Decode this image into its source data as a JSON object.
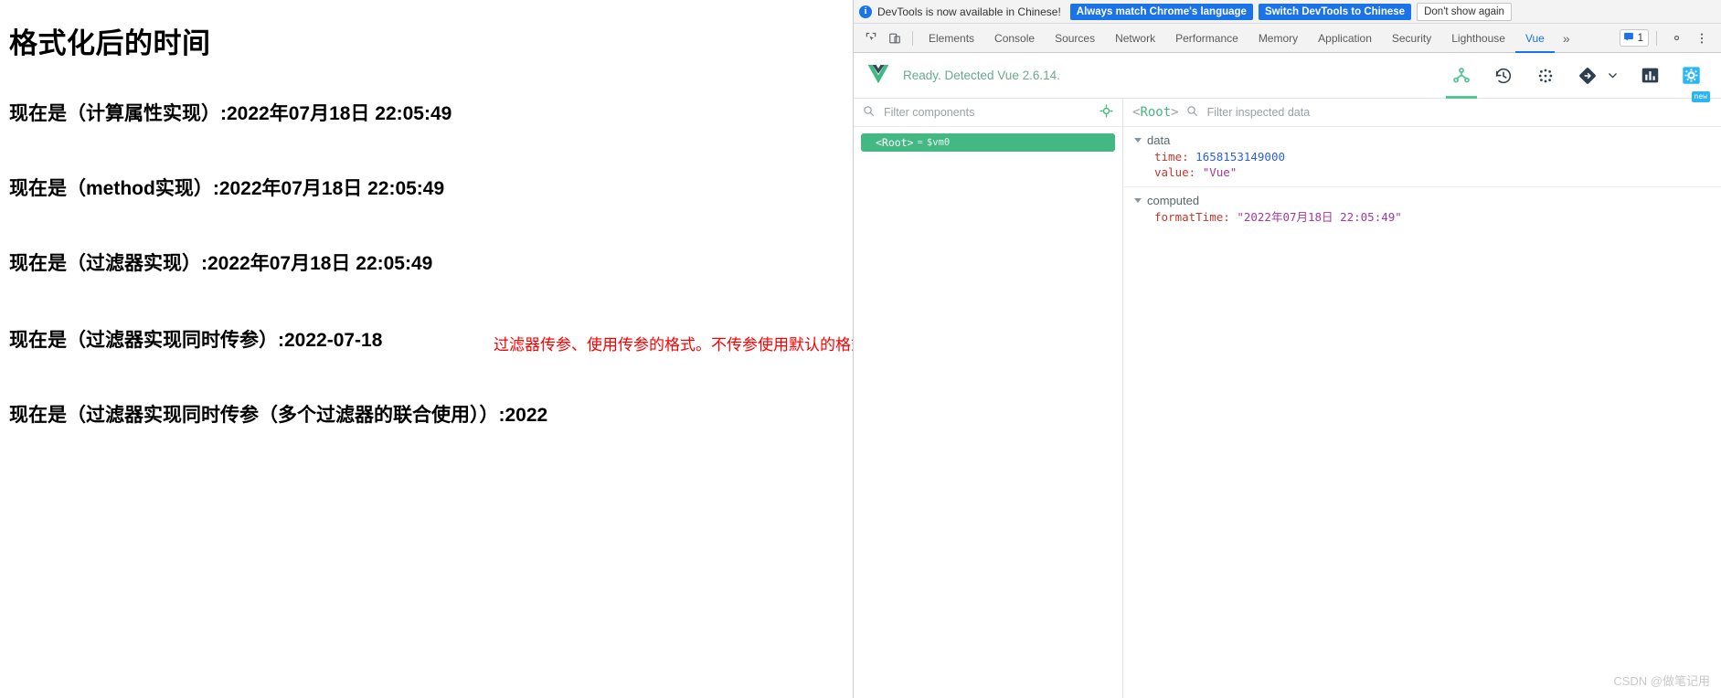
{
  "page": {
    "title": "格式化后的时间",
    "lines": [
      "现在是（计算属性实现）:2022年07月18日 22:05:49",
      "现在是（method实现）:2022年07月18日 22:05:49",
      "现在是（过滤器实现）:2022年07月18日 22:05:49",
      "现在是（过滤器实现同时传参）:2022-07-18",
      "现在是（过滤器实现同时传参（多个过滤器的联合使用））:2022"
    ],
    "note": "过滤器传参、使用传参的格式。不传参使用默认的格式",
    "note_color": "#ff0000"
  },
  "devtools": {
    "notification": {
      "icon": "info-icon",
      "message": "DevTools is now available in Chinese!",
      "primary_button": "Always match Chrome's language",
      "secondary_button": "Switch DevTools to Chinese",
      "dismiss_button": "Don't show again",
      "accent": "#1a73e8"
    },
    "toolbar": {
      "inspect_icon": "inspect-element-icon",
      "device_icon": "device-toolbar-icon",
      "tabs": [
        "Elements",
        "Console",
        "Sources",
        "Network",
        "Performance",
        "Memory",
        "Application",
        "Security",
        "Lighthouse",
        "Vue"
      ],
      "active_tab": "Vue",
      "more_tabs_icon": "chevron-double-right-icon",
      "message_count": "1",
      "message_icon": "message-icon",
      "settings_icon": "gear-icon",
      "menu_icon": "kebab-menu-icon",
      "active_color": "#1a73e8"
    },
    "vue": {
      "logo": "vue-logo-icon",
      "status": "Ready. Detected Vue 2.6.14.",
      "status_color": "#6aab8e",
      "accent": "#44b883",
      "actions": [
        {
          "name": "components-tree-icon",
          "active": true,
          "badge": ""
        },
        {
          "name": "timeline-history-icon",
          "active": false,
          "badge": ""
        },
        {
          "name": "vuex-icon",
          "active": false,
          "badge": ""
        },
        {
          "name": "routing-icon",
          "active": false,
          "badge": ""
        },
        {
          "name": "performance-icon",
          "active": false,
          "badge": ""
        },
        {
          "name": "settings-gear-icon",
          "active": false,
          "badge": "new"
        }
      ],
      "tree": {
        "search_icon": "search-icon",
        "filter_placeholder": "Filter components",
        "filter_value": "",
        "target_icon": "select-in-page-icon",
        "nodes": [
          {
            "tag": "<Root>",
            "eq": "=",
            "vm": "$vm0",
            "selected": true
          }
        ]
      },
      "inspector": {
        "root_label": "<Root>",
        "search_icon": "search-icon",
        "filter_placeholder": "Filter inspected data",
        "filter_value": "",
        "groups": [
          {
            "name": "data",
            "expanded": true,
            "rows": [
              {
                "key": "time",
                "value": "1658153149000",
                "kind": "number"
              },
              {
                "key": "value",
                "value": "\"Vue\"",
                "kind": "string"
              }
            ]
          },
          {
            "name": "computed",
            "expanded": true,
            "rows": [
              {
                "key": "formatTime",
                "value": "\"2022年07月18日 22:05:49\"",
                "kind": "string"
              }
            ]
          }
        ]
      }
    }
  },
  "watermark": "CSDN @做笔记用"
}
